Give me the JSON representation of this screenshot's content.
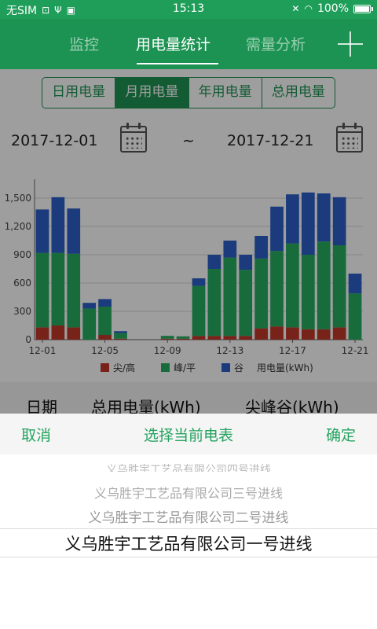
{
  "status_bar": {
    "carrier": "无SIM",
    "time": "15:13",
    "battery": "100%"
  },
  "nav": {
    "tabs": [
      {
        "label": "监控",
        "active": false
      },
      {
        "label": "用电量统计",
        "active": true
      },
      {
        "label": "需量分析",
        "active": false
      }
    ]
  },
  "segments": [
    {
      "label": "日用电量",
      "active": false
    },
    {
      "label": "月用电量",
      "active": true
    },
    {
      "label": "年用电量",
      "active": false
    },
    {
      "label": "总用电量",
      "active": false
    }
  ],
  "date_range": {
    "start": "2017-12-01",
    "separator": "~",
    "end": "2017-12-21"
  },
  "chart_data": {
    "type": "bar",
    "stacked": true,
    "categories": [
      "12-01",
      "12-02",
      "12-03",
      "12-04",
      "12-05",
      "12-06",
      "12-07",
      "12-08",
      "12-09",
      "12-10",
      "12-11",
      "12-12",
      "12-13",
      "12-14",
      "12-15",
      "12-16",
      "12-17",
      "12-18",
      "12-19",
      "12-20",
      "12-21"
    ],
    "x_tick_labels": [
      "12-01",
      "12-05",
      "12-09",
      "12-13",
      "12-17",
      "12-21"
    ],
    "series": [
      {
        "name": "尖/高",
        "color": "#c0392b",
        "values": [
          130,
          150,
          130,
          0,
          50,
          10,
          0,
          0,
          10,
          10,
          40,
          40,
          40,
          40,
          120,
          140,
          130,
          110,
          110,
          130,
          0
        ]
      },
      {
        "name": "峰/平",
        "color": "#27ae60",
        "values": [
          790,
          770,
          780,
          330,
          300,
          60,
          0,
          0,
          30,
          25,
          530,
          710,
          830,
          700,
          740,
          800,
          890,
          790,
          930,
          870,
          490
        ]
      },
      {
        "name": "谷",
        "color": "#2c5fc9",
        "values": [
          460,
          590,
          480,
          60,
          80,
          20,
          0,
          0,
          0,
          0,
          80,
          150,
          180,
          160,
          240,
          470,
          520,
          660,
          510,
          510,
          210
        ]
      }
    ],
    "legend_extra": "用电量(kWh)",
    "yticks": [
      "0",
      "300",
      "600",
      "900",
      "1,200",
      "1,500"
    ],
    "ylim": [
      0,
      1700
    ],
    "grid": true,
    "legend_position": "bottom"
  },
  "table_header": [
    "日期",
    "总用电量(kWh)",
    "尖峰谷(kWh)"
  ],
  "picker": {
    "cancel": "取消",
    "title": "选择当前电表",
    "confirm": "确定",
    "items": [
      "义乌胜宇工艺品有限公司四号进线",
      "义乌胜宇工艺品有限公司三号进线",
      "义乌胜宇工艺品有限公司二号进线",
      "义乌胜宇工艺品有限公司一号进线"
    ],
    "selected_index": 3
  }
}
